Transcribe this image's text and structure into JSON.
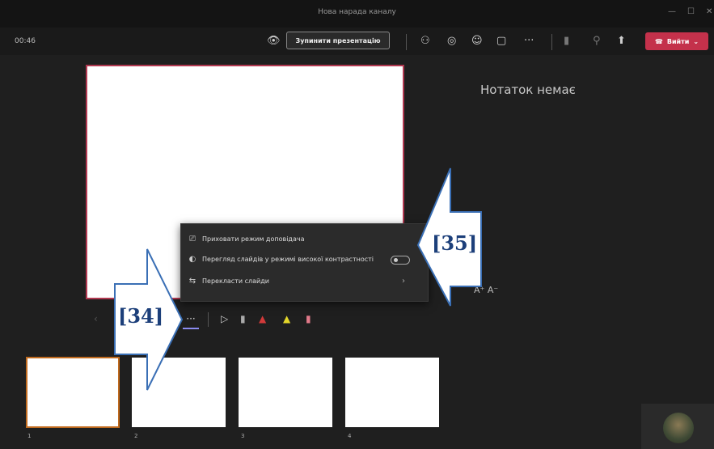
{
  "window": {
    "title": "Нова нарада каналу",
    "min_icon": "minimize-icon",
    "max_icon": "maximize-icon",
    "close_icon": "close-icon"
  },
  "toolbar": {
    "timer": "00:46",
    "stop_label": "Зупинити презентацію",
    "icons": [
      "eye-icon",
      "people-icon",
      "chat-icon",
      "reactions-icon",
      "share-screen-icon",
      "more-icon",
      "camera-off-icon",
      "mic-off-icon",
      "share-tray-icon"
    ],
    "leave_label": "Вийти",
    "leave_color": "#c4314b"
  },
  "notes": {
    "empty_text": "Нотаток немає",
    "font_controls": "A⁺ A⁻"
  },
  "menu": {
    "items": [
      {
        "label": "Приховати режим доповідача",
        "icon": "presenter-icon"
      },
      {
        "label": "Перегляд слайдів у режимі високої контрастності",
        "icon": "contrast-icon"
      },
      {
        "label": "Перекласти слайди",
        "icon": "translate-icon"
      }
    ]
  },
  "annotations": {
    "callout_34": "[34]",
    "callout_35": "[35]"
  },
  "tools": [
    "more-options-icon",
    "pointer-icon",
    "pen-icon",
    "laser-icon",
    "highlighter-icon",
    "eraser-icon"
  ],
  "thumbnails": [
    "1",
    "2",
    "3",
    "4"
  ],
  "colors": {
    "accent": "#8b8cf0",
    "slide_border": "#b03850",
    "thumb_selected": "#c06a1e"
  }
}
